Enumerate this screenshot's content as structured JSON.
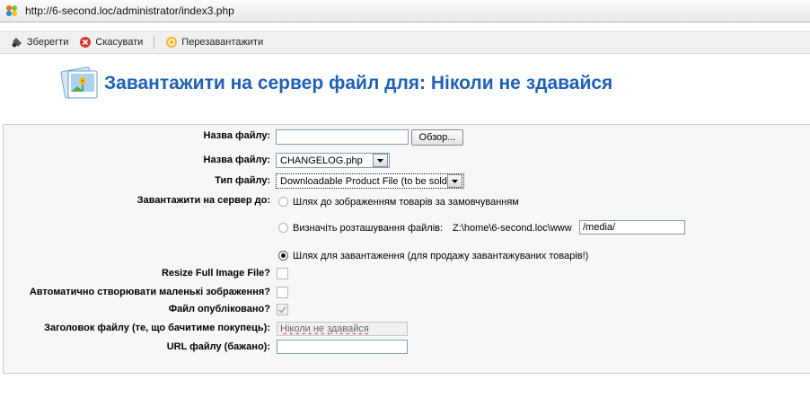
{
  "address_bar": {
    "url": "http://6-second.loc/administrator/index3.php"
  },
  "toolbar": {
    "save_label": "Зберегти",
    "cancel_label": "Скасувати",
    "reload_label": "Перезавантажити"
  },
  "page": {
    "title": "Завантажити на сервер файл для: Ніколи не здавайся"
  },
  "form": {
    "file_upload": {
      "label": "Назва файлу:",
      "value": "",
      "browse_label": "Обзор..."
    },
    "file_name": {
      "label": "Назва файлу:",
      "selected": "CHANGELOG.php"
    },
    "file_type": {
      "label": "Тип файлу:",
      "selected": "Downloadable Product File (to be sold!)"
    },
    "upload_to": {
      "label": "Завантажити на сервер до:",
      "options": [
        {
          "label": "Шлях до зображенням товарів за замовчуванням",
          "checked": false
        },
        {
          "label": "Визначіть розташування файлів:",
          "path_prefix": "Z:\\home\\6-second.loc\\www",
          "path_value": "/media/",
          "checked": false
        },
        {
          "label": "Шлях для завантаження (для продажу завантажуваних товарів!)",
          "checked": true
        }
      ]
    },
    "resize_full_image": {
      "label": "Resize Full Image File?",
      "checked": false
    },
    "auto_thumbnails": {
      "label": "Автоматично створювати маленькі зображення?",
      "checked": false
    },
    "published": {
      "label": "Файл опубліковано?",
      "checked": true
    },
    "file_title": {
      "label": "Заголовок файлу (те, що бачитиме покупець):",
      "value": "Ніколи не здавайся"
    },
    "file_url": {
      "label": "URL файлу (бажано):",
      "value": ""
    }
  },
  "colors": {
    "title": "#1f61b6",
    "panel_bg": "#f7f7f7"
  }
}
